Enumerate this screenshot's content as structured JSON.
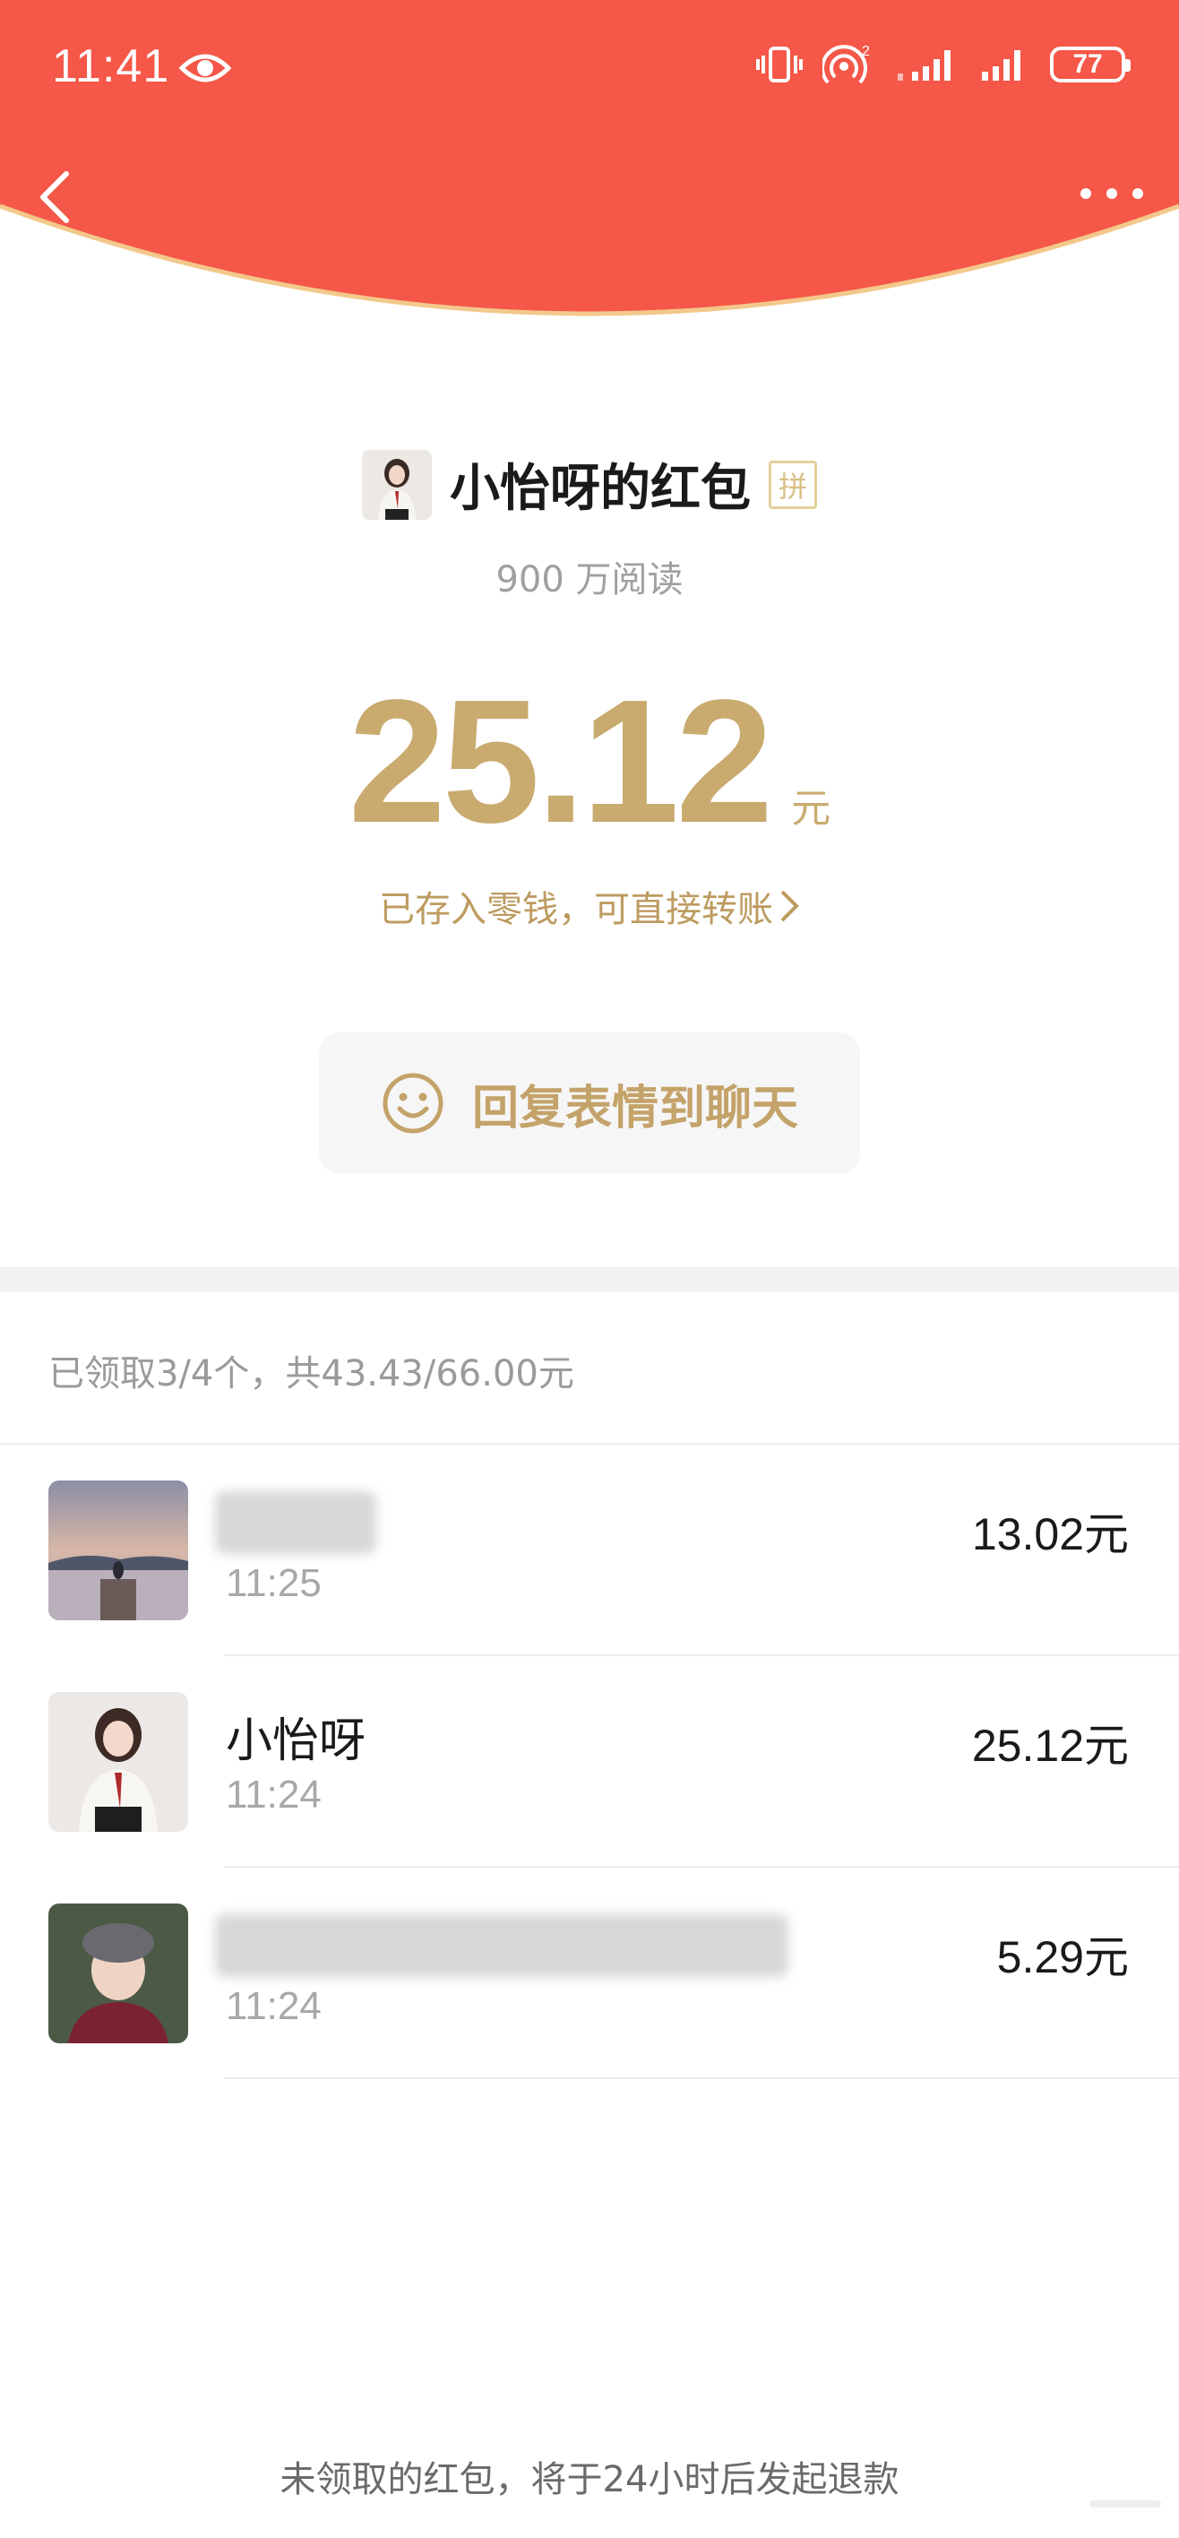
{
  "status_bar": {
    "time": "11:41",
    "network_sup": "2",
    "battery": "77"
  },
  "header": {
    "color": "#f55748",
    "edge_color": "#f3c88a"
  },
  "packet": {
    "sender_name": "小怡呀的红包",
    "badge": "拼",
    "reads": "900 万阅读",
    "amount": "25.12",
    "unit": "元",
    "stored_note": "已存入零钱，可直接转账",
    "reply_label": "回复表情到聊天"
  },
  "summary": "已领取3/4个，共43.43/66.00元",
  "recipients": [
    {
      "name": "",
      "time": "11:25",
      "amount": "13.02元",
      "avatar": "lake-sunset-avatar"
    },
    {
      "name": "小怡呀",
      "time": "11:24",
      "amount": "25.12元",
      "avatar": "girl-portrait-avatar"
    },
    {
      "name": "",
      "time": "11:24",
      "amount": "5.29元",
      "avatar": "girl-helmet-avatar"
    }
  ],
  "footer_note": "未领取的红包，将于24小时后发起退款",
  "colors": {
    "gold": "#c9aa6f",
    "red": "#f55748"
  }
}
